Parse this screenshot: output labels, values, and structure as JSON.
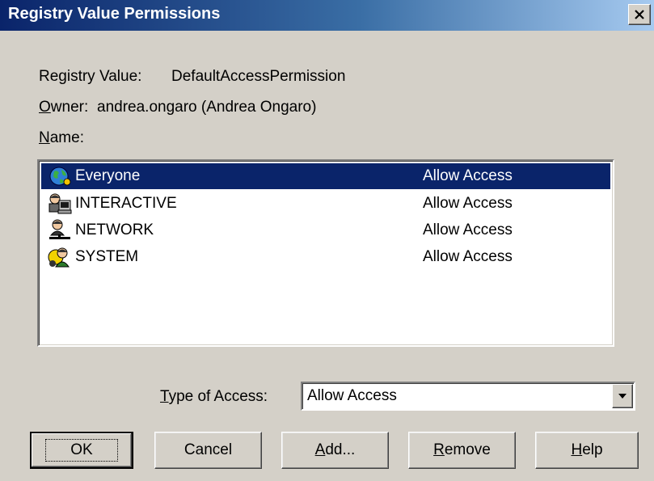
{
  "window": {
    "title": "Registry Value Permissions",
    "close_label": "×"
  },
  "info": {
    "registry_value_label": "Registry Value:",
    "registry_value": "DefaultAccessPermission",
    "owner_label": "Owner:",
    "owner_value": "andrea.ongaro (Andrea Ongaro)",
    "name_label": "Name:"
  },
  "names": [
    {
      "name": "Everyone",
      "access": "Allow Access",
      "icon": "globe-icon",
      "selected": true
    },
    {
      "name": "INTERACTIVE",
      "access": "Allow Access",
      "icon": "interactive-users-icon",
      "selected": false
    },
    {
      "name": "NETWORK",
      "access": "Allow Access",
      "icon": "network-user-icon",
      "selected": false
    },
    {
      "name": "SYSTEM",
      "access": "Allow Access",
      "icon": "system-users-icon",
      "selected": false
    }
  ],
  "type_of_access": {
    "label": "Type of Access:",
    "value": "Allow Access"
  },
  "buttons": {
    "ok": "OK",
    "cancel": "Cancel",
    "add": "Add...",
    "remove": "Remove",
    "help": "Help"
  },
  "colors": {
    "selection": "#0a246a",
    "face": "#d4d0c8"
  }
}
